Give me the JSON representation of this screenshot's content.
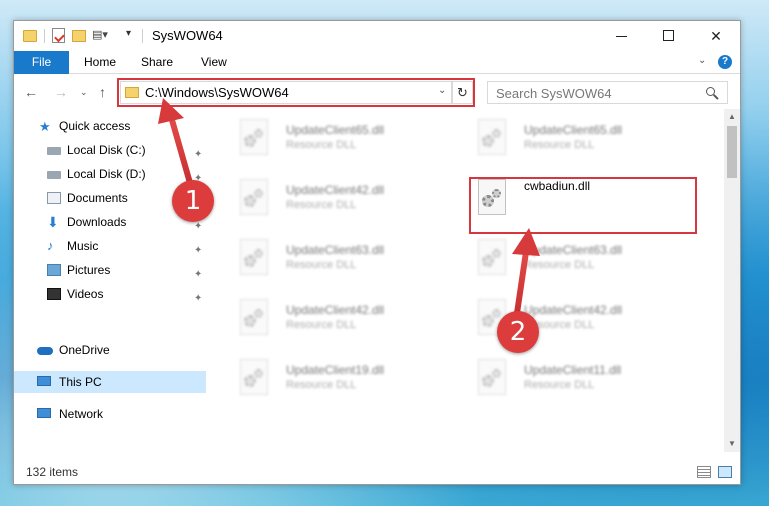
{
  "window": {
    "title": "SysWOW64",
    "minimize_glyph": "",
    "maximize_glyph": "",
    "close_glyph": "✕"
  },
  "ribbon": {
    "tabs": [
      "File",
      "Home",
      "Share",
      "View"
    ],
    "expand_glyph": "⌄",
    "help_glyph": "?"
  },
  "navigation": {
    "back_glyph": "←",
    "forward_glyph": "→",
    "recent_glyph": "⌄",
    "up_glyph": "↑",
    "address_path": "C:\\Windows\\SysWOW64",
    "address_drop_glyph": "⌄",
    "refresh_glyph": "↻",
    "search_placeholder": "Search SysWOW64"
  },
  "nav_pane": {
    "items": [
      {
        "label": "Quick access",
        "icon": "star-icon",
        "pinned": false
      },
      {
        "label": "Local Disk (C:)",
        "icon": "disk-icon",
        "pinned": true
      },
      {
        "label": "Local Disk (D:)",
        "icon": "disk-icon",
        "pinned": true
      },
      {
        "label": "Documents",
        "icon": "documents-icon",
        "pinned": true
      },
      {
        "label": "Downloads",
        "icon": "download-icon",
        "pinned": true
      },
      {
        "label": "Music",
        "icon": "music-icon",
        "pinned": true
      },
      {
        "label": "Pictures",
        "icon": "pictures-icon",
        "pinned": true
      },
      {
        "label": "Videos",
        "icon": "videos-icon",
        "pinned": true
      },
      {
        "label": "OneDrive",
        "icon": "cloud-icon",
        "pinned": false
      },
      {
        "label": "This PC",
        "icon": "computer-icon",
        "pinned": false,
        "selected": true
      },
      {
        "label": "Network",
        "icon": "network-icon",
        "pinned": false
      }
    ],
    "pin_glyph": "📌"
  },
  "files": [
    {
      "name": "UpdateClient65.dll",
      "type": "Resource DLL",
      "blurred": true
    },
    {
      "name": "UpdateClient65.dll",
      "type": "Resource DLL",
      "blurred": true
    },
    {
      "name": "UpdateClient42.dll",
      "type": "Resource DLL",
      "blurred": true
    },
    {
      "name": "cwbadiun.dll",
      "type": "",
      "blurred": false,
      "highlighted": true
    },
    {
      "name": "UpdateClient63.dll",
      "type": "Resource DLL",
      "blurred": true
    },
    {
      "name": "UpdateClient63.dll",
      "type": "Resource DLL",
      "blurred": true
    },
    {
      "name": "UpdateClient42.dll",
      "type": "Resource DLL",
      "blurred": true
    },
    {
      "name": "UpdateClient42.dll",
      "type": "Resource DLL",
      "blurred": true
    },
    {
      "name": "UpdateClient19.dll",
      "type": "Resource DLL",
      "blurred": true
    },
    {
      "name": "UpdateClient11.dll",
      "type": "Resource DLL",
      "blurred": true
    }
  ],
  "status": {
    "item_count": "132 items"
  },
  "callouts": {
    "step1": "1",
    "step2": "2",
    "accent_color": "#dc3c3c"
  }
}
